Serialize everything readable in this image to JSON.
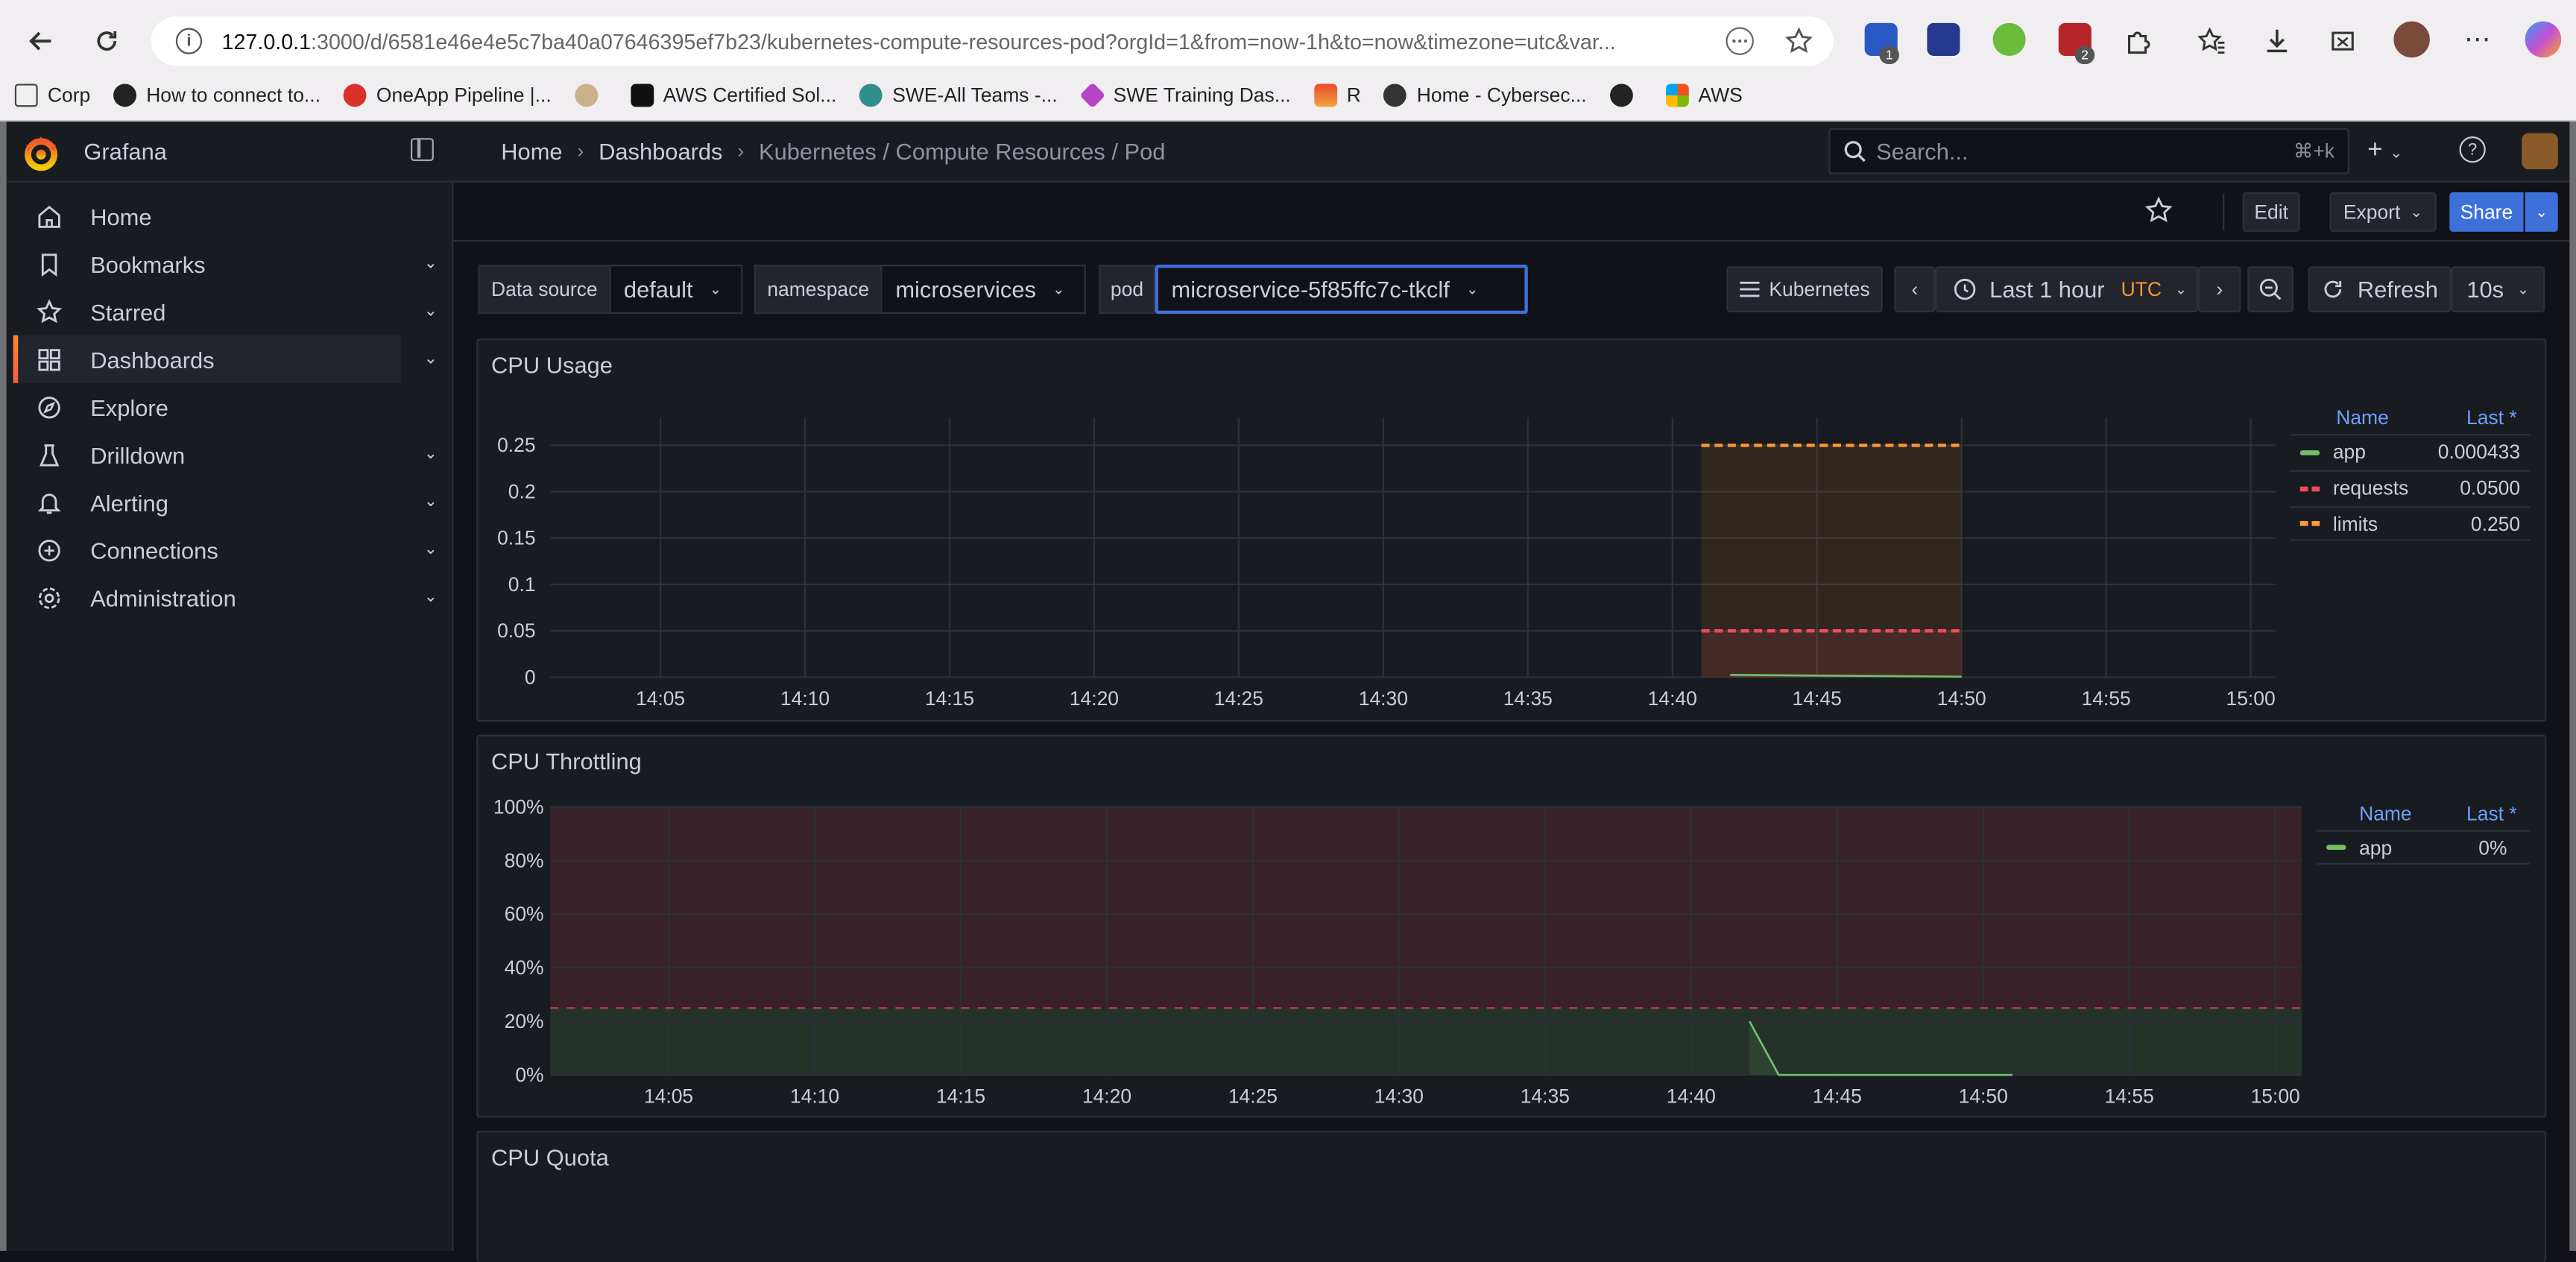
{
  "browser": {
    "url_host": "127.0.0.1",
    "url_path": ":3000/d/6581e46e4e5c7ba40a07646395ef7b23/kubernetes-compute-resources-pod?orgId=1&from=now-1h&to=now&timezone=utc&var...",
    "bookmarks": [
      "Corp",
      "How to connect to...",
      "OneApp Pipeline |...",
      "",
      "AWS Certified Sol...",
      "SWE-All Teams -...",
      "SWE Training Das...",
      "R",
      "Home - Cybersec...",
      "",
      "AWS"
    ],
    "ext_badges": [
      "1",
      "2"
    ]
  },
  "grafana": {
    "brand": "Grafana",
    "breadcrumb": [
      "Home",
      "Dashboards",
      "Kubernetes / Compute Resources / Pod"
    ],
    "search_placeholder": "Search...",
    "search_shortcut": "⌘+k",
    "plus_label": "+"
  },
  "sidebar": {
    "items": [
      {
        "label": "Home",
        "icon": "home-icon"
      },
      {
        "label": "Bookmarks",
        "icon": "bookmark-icon"
      },
      {
        "label": "Starred",
        "icon": "star-icon"
      },
      {
        "label": "Dashboards",
        "icon": "dashboards-icon"
      },
      {
        "label": "Explore",
        "icon": "explore-icon"
      },
      {
        "label": "Drilldown",
        "icon": "drilldown-icon"
      },
      {
        "label": "Alerting",
        "icon": "bell-icon"
      },
      {
        "label": "Connections",
        "icon": "connections-icon"
      },
      {
        "label": "Administration",
        "icon": "gear-icon"
      }
    ]
  },
  "toolbar": {
    "edit": "Edit",
    "export": "Export",
    "share": "Share"
  },
  "variables": [
    {
      "label": "Data source",
      "value": "default"
    },
    {
      "label": "namespace",
      "value": "microservices"
    },
    {
      "label": "pod",
      "value": "microservice-5f85ffc7c-tkclf"
    }
  ],
  "controls": {
    "kubernetes": "Kubernetes",
    "time_range": "Last 1 hour",
    "timezone": "UTC",
    "refresh": "Refresh",
    "refresh_interval": "10s"
  },
  "panels": {
    "cpu_usage": {
      "title": "CPU Usage",
      "legend_header": [
        "Name",
        "Last *"
      ],
      "legend": [
        {
          "name": "app",
          "last": "0.000433",
          "color": "#73bf69"
        },
        {
          "name": "requests",
          "last": "0.0500",
          "color": "#f2495c"
        },
        {
          "name": "limits",
          "last": "0.250",
          "color": "#ff9830"
        }
      ]
    },
    "cpu_throttling": {
      "title": "CPU Throttling",
      "legend_header": [
        "Name",
        "Last *"
      ],
      "legend": [
        {
          "name": "app",
          "last": "0%",
          "color": "#73bf69"
        }
      ]
    },
    "cpu_quota": {
      "title": "CPU Quota"
    }
  },
  "chart_data": [
    {
      "type": "line",
      "title": "CPU Usage",
      "x_ticks": [
        "14:05",
        "14:10",
        "14:15",
        "14:20",
        "14:25",
        "14:30",
        "14:35",
        "14:40",
        "14:45",
        "14:50",
        "14:55",
        "15:00"
      ],
      "y_ticks": [
        "0",
        "0.05",
        "0.1",
        "0.15",
        "0.2",
        "0.25"
      ],
      "ylim": [
        0,
        0.28
      ],
      "series": [
        {
          "name": "app",
          "color": "#73bf69",
          "dash": false,
          "points": [
            [
              "14:42",
              0.0025
            ],
            [
              "14:46",
              0.0015
            ],
            [
              "14:50",
              0.0005
            ]
          ]
        },
        {
          "name": "requests",
          "color": "#f2495c",
          "dash": true,
          "points": [
            [
              "14:41",
              0.05
            ],
            [
              "14:50",
              0.05
            ]
          ]
        },
        {
          "name": "limits",
          "color": "#ff9830",
          "dash": true,
          "points": [
            [
              "14:41",
              0.25
            ],
            [
              "14:50",
              0.25
            ]
          ]
        }
      ],
      "legend_position": "right"
    },
    {
      "type": "line",
      "title": "CPU Throttling",
      "x_ticks": [
        "14:05",
        "14:10",
        "14:15",
        "14:20",
        "14:25",
        "14:30",
        "14:35",
        "14:40",
        "14:45",
        "14:50",
        "14:55",
        "15:00"
      ],
      "y_ticks": [
        "0%",
        "20%",
        "40%",
        "60%",
        "80%",
        "100%"
      ],
      "ylim": [
        0,
        100
      ],
      "threshold": 25,
      "series": [
        {
          "name": "app",
          "color": "#73bf69",
          "dash": false,
          "points": [
            [
              "14:42",
              20
            ],
            [
              "14:43",
              0
            ],
            [
              "14:51",
              0
            ]
          ]
        }
      ],
      "legend_position": "right"
    }
  ]
}
